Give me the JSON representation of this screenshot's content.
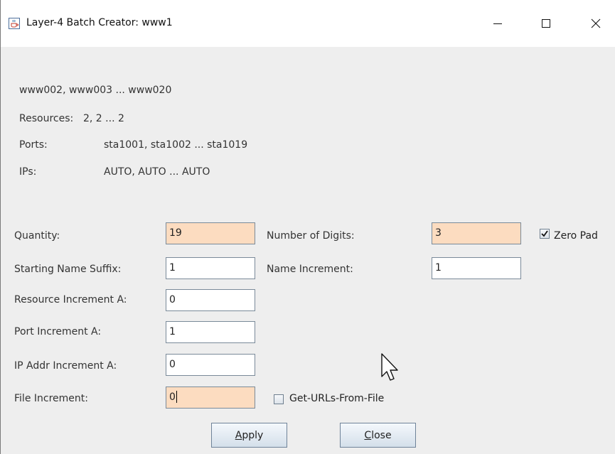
{
  "window": {
    "title": "Layer-4 Batch Creator: www1",
    "app_icon": "java-cup-icon",
    "controls": {
      "minimize": "minimize-icon",
      "maximize": "maximize-icon",
      "close": "close-icon"
    }
  },
  "summary": {
    "names": "www002, www003 ... www020",
    "resources_label": "Resources:",
    "resources_value": "2, 2 ... 2",
    "ports_label": "Ports:",
    "ports_value": "sta1001, sta1002 ... sta1019",
    "ips_label": "IPs:",
    "ips_value": "AUTO, AUTO ... AUTO"
  },
  "form": {
    "quantity": {
      "label": "Quantity:",
      "value": "19"
    },
    "num_digits": {
      "label": "Number of Digits:",
      "value": "3"
    },
    "zero_pad": {
      "label": "Zero Pad",
      "checked": true
    },
    "start_suffix": {
      "label": "Starting Name Suffix:",
      "value": "1"
    },
    "name_increment": {
      "label": "Name Increment:",
      "value": "1"
    },
    "resource_increment": {
      "label": "Resource Increment A:",
      "value": "0"
    },
    "port_increment": {
      "label": "Port Increment A:",
      "value": "1"
    },
    "ip_increment": {
      "label": "IP Addr Increment A:",
      "value": "0"
    },
    "file_increment": {
      "label": "File Increment:",
      "value": "0"
    },
    "get_urls": {
      "label": "Get-URLs-From-File",
      "checked": false
    }
  },
  "buttons": {
    "apply": {
      "mnemonic": "A",
      "rest": "pply"
    },
    "close": {
      "mnemonic": "C",
      "rest": "lose"
    }
  },
  "colors": {
    "highlight_field": "#fcdcc0",
    "window_bg": "#eeeeee"
  }
}
